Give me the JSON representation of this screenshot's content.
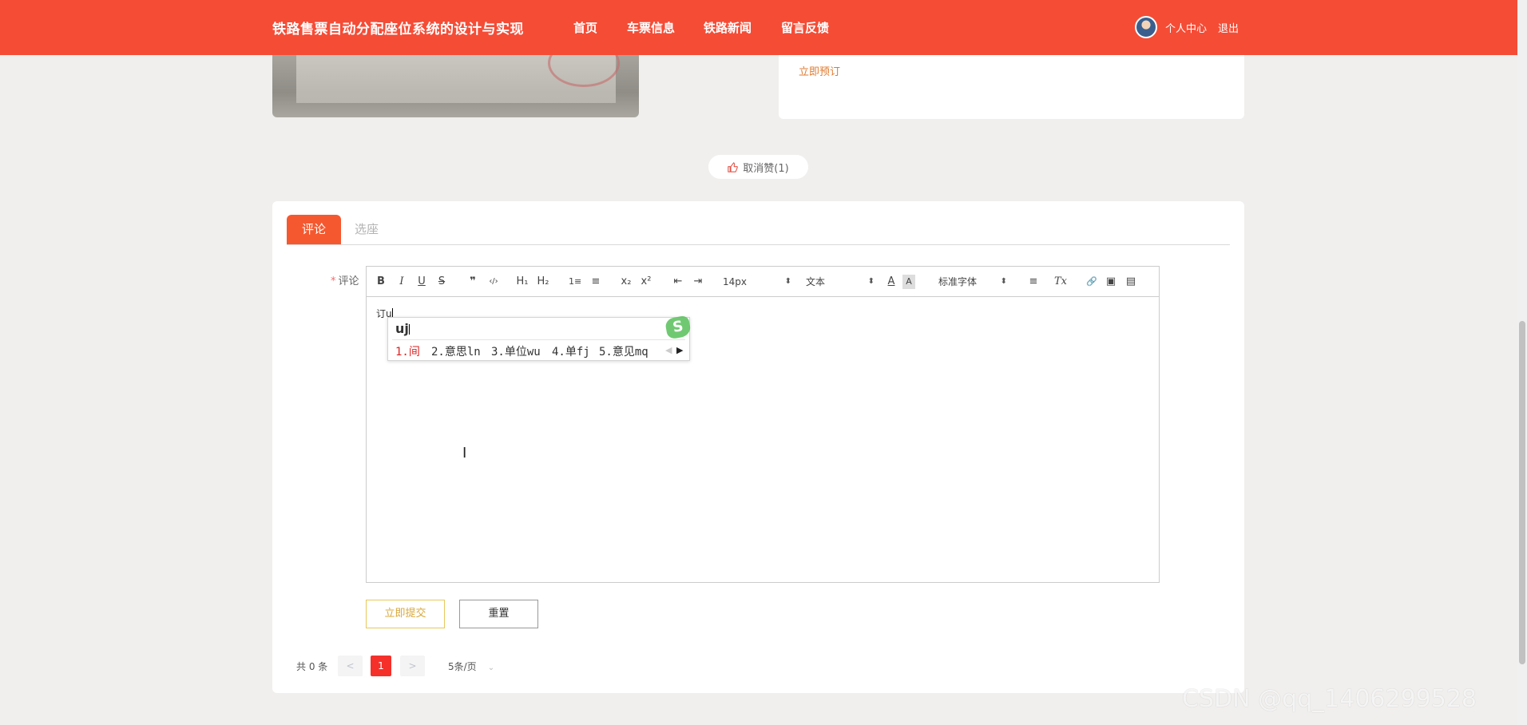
{
  "header": {
    "site_title": "铁路售票自动分配座位系统的设计与实现",
    "nav": [
      "首页",
      "车票信息",
      "铁路新闻",
      "留言反馈"
    ],
    "user_center": "个人中心",
    "logout": "退出",
    "bar_color": "#f54c36"
  },
  "detail": {
    "book_now": "立即预订",
    "like_button": "取消赞(1)"
  },
  "tabs": [
    "评论",
    "选座"
  ],
  "form": {
    "comment_label": "评论",
    "required_mark": "*"
  },
  "editor": {
    "toolbar": {
      "bold": "B",
      "italic": "I",
      "underline": "U",
      "strike": "S",
      "quote": "❞",
      "code": "‹/›",
      "h1": "H₁",
      "h2": "H₂",
      "ordered_list": "1≡",
      "bullet_list": "≡",
      "subscript": "x₂",
      "superscript": "x²",
      "outdent": "⇤",
      "indent": "⇥",
      "size_select": "14px",
      "header_select": "文本",
      "font_color": "A",
      "bg_color": "A",
      "font_select": "标准字体",
      "align": "≡",
      "clean": "Tx",
      "link": "🔗",
      "image": "▣",
      "video": "▤"
    },
    "content": "订u"
  },
  "ime": {
    "composition": "uj",
    "candidates": [
      "1.间",
      "2.意思ln",
      "3.单位wu",
      "4.单fj",
      "5.意见mq"
    ],
    "logo": "S"
  },
  "buttons": {
    "submit": "立即提交",
    "reset": "重置"
  },
  "pagination": {
    "total": "共 0 条",
    "prev": "<",
    "current_page": "1",
    "next": ">",
    "page_size": "5条/页"
  },
  "watermark": "CSDN @qq_1406299528"
}
